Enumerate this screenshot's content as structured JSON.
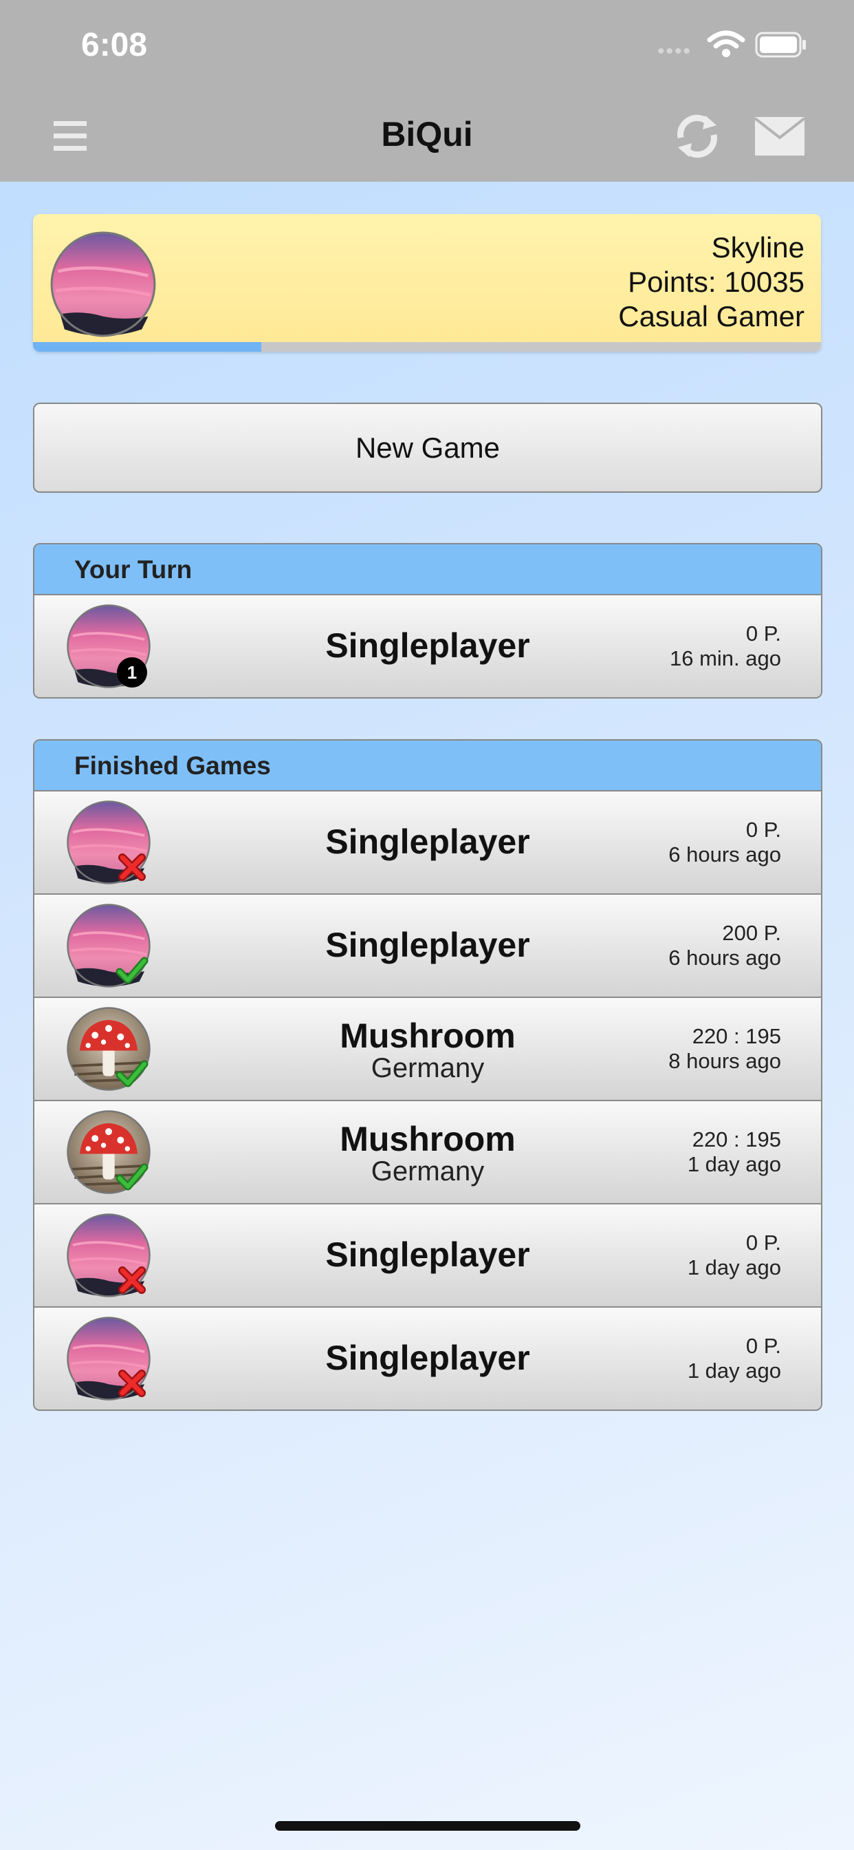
{
  "status_bar": {
    "time": "6:08"
  },
  "nav": {
    "title": "BiQui",
    "icons": [
      "menu-icon",
      "refresh-icon",
      "mail-icon"
    ]
  },
  "profile": {
    "name": "Skyline",
    "points": "Points: 10035",
    "rank": "Casual Gamer",
    "progress_fraction": 0.29,
    "avatar": "sunset-avatar"
  },
  "new_game_label": "New Game",
  "your_turn": {
    "header": "Your Turn",
    "games": [
      {
        "title": "Singleplayer",
        "score": "0 P.",
        "time": "16 min. ago",
        "badge": "1",
        "avatar": "sunset"
      }
    ]
  },
  "finished": {
    "header": "Finished Games",
    "games": [
      {
        "title": "Singleplayer",
        "subtitle": "",
        "score": "0 P.",
        "time": "6 hours ago",
        "result": "lost",
        "avatar": "sunset"
      },
      {
        "title": "Singleplayer",
        "subtitle": "",
        "score": "200 P.",
        "time": "6 hours ago",
        "result": "won",
        "avatar": "sunset"
      },
      {
        "title": "Mushroom",
        "subtitle": "Germany",
        "score": "220 : 195",
        "time": "8 hours ago",
        "result": "won",
        "avatar": "mushroom"
      },
      {
        "title": "Mushroom",
        "subtitle": "Germany",
        "score": "220 : 195",
        "time": "1 day ago",
        "result": "won",
        "avatar": "mushroom"
      },
      {
        "title": "Singleplayer",
        "subtitle": "",
        "score": "0 P.",
        "time": "1 day ago",
        "result": "lost",
        "avatar": "sunset"
      },
      {
        "title": "Singleplayer",
        "subtitle": "",
        "score": "0 P.",
        "time": "1 day ago",
        "result": "lost",
        "avatar": "sunset"
      }
    ]
  },
  "colors": {
    "nav_bar": "#b3b3b3",
    "profile_card": "#ffeea0",
    "section_header": "#7fbff8",
    "progress_fill": "#6fb3f4",
    "win_mark": "#2fa52f",
    "loss_mark": "#e22222"
  }
}
